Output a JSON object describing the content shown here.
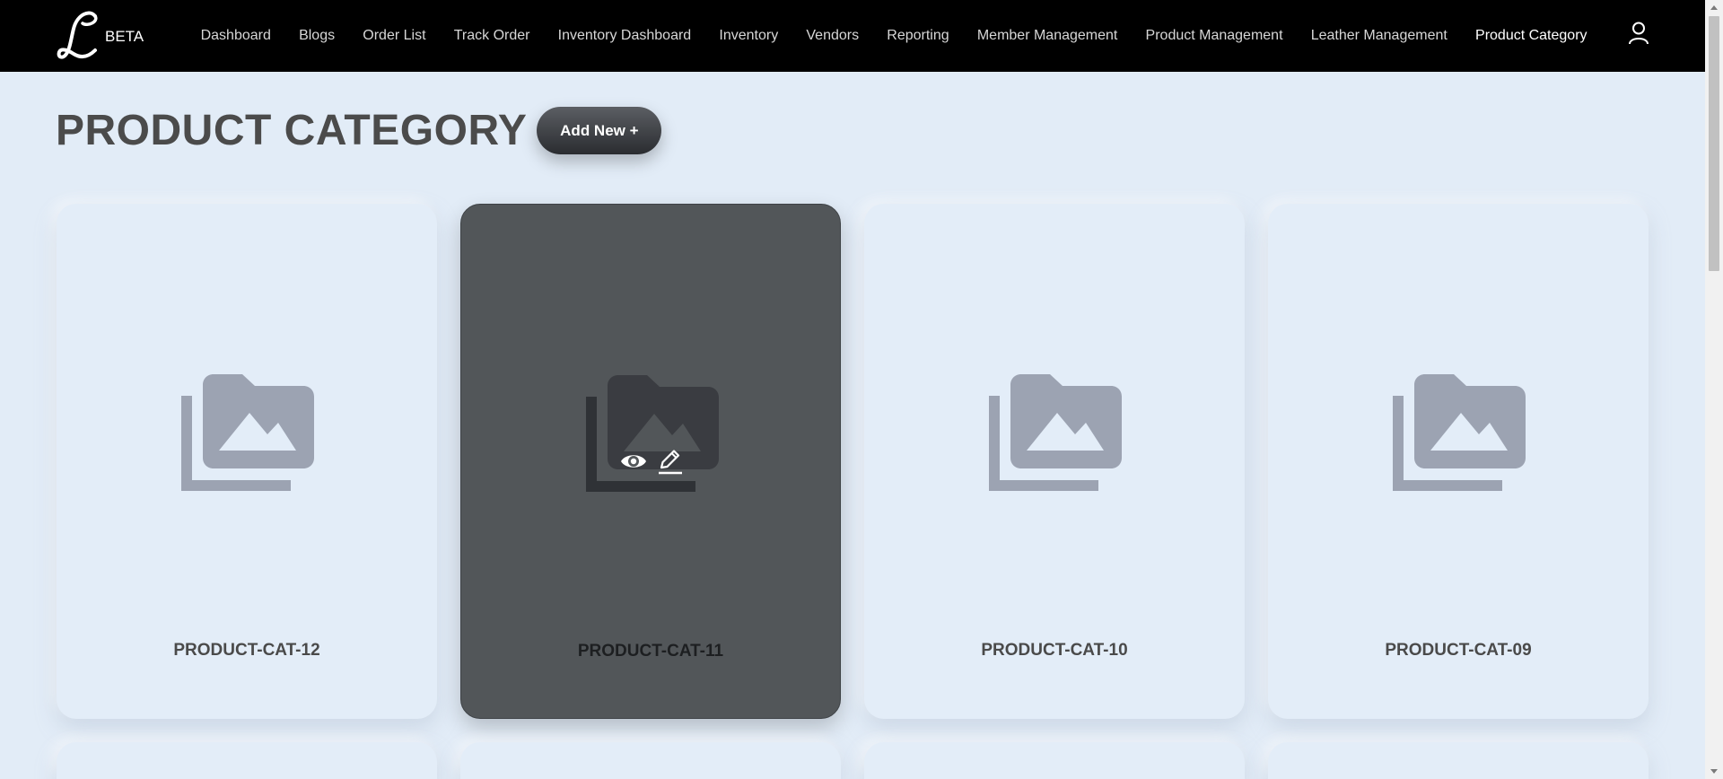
{
  "brand": {
    "logo_letter": "L",
    "badge": "BETA"
  },
  "nav": {
    "items": [
      {
        "label": "Dashboard"
      },
      {
        "label": "Blogs"
      },
      {
        "label": "Order List"
      },
      {
        "label": "Track Order"
      },
      {
        "label": "Inventory Dashboard"
      },
      {
        "label": "Inventory"
      },
      {
        "label": "Vendors"
      },
      {
        "label": "Reporting"
      },
      {
        "label": "Member Management"
      },
      {
        "label": "Product Management"
      },
      {
        "label": "Leather Management"
      },
      {
        "label": "Product Category"
      }
    ],
    "active": "Product Category",
    "user_icon": "user-icon"
  },
  "page": {
    "title": "PRODUCT CATEGORY",
    "add_button": "Add New +"
  },
  "cards": [
    {
      "label": "PRODUCT-CAT-12",
      "icon": "image-folder-icon"
    },
    {
      "label": "PRODUCT-CAT-11",
      "icon": "image-folder-icon",
      "hovered": true,
      "actions": [
        "view-icon",
        "edit-icon"
      ]
    },
    {
      "label": "PRODUCT-CAT-10",
      "icon": "image-folder-icon"
    },
    {
      "label": "PRODUCT-CAT-09",
      "icon": "image-folder-icon"
    }
  ],
  "colors": {
    "navbar": "#000000",
    "background": "#e2ecf7",
    "card_hover": "#525659",
    "placeholder_icon": "#9ca3b2"
  }
}
